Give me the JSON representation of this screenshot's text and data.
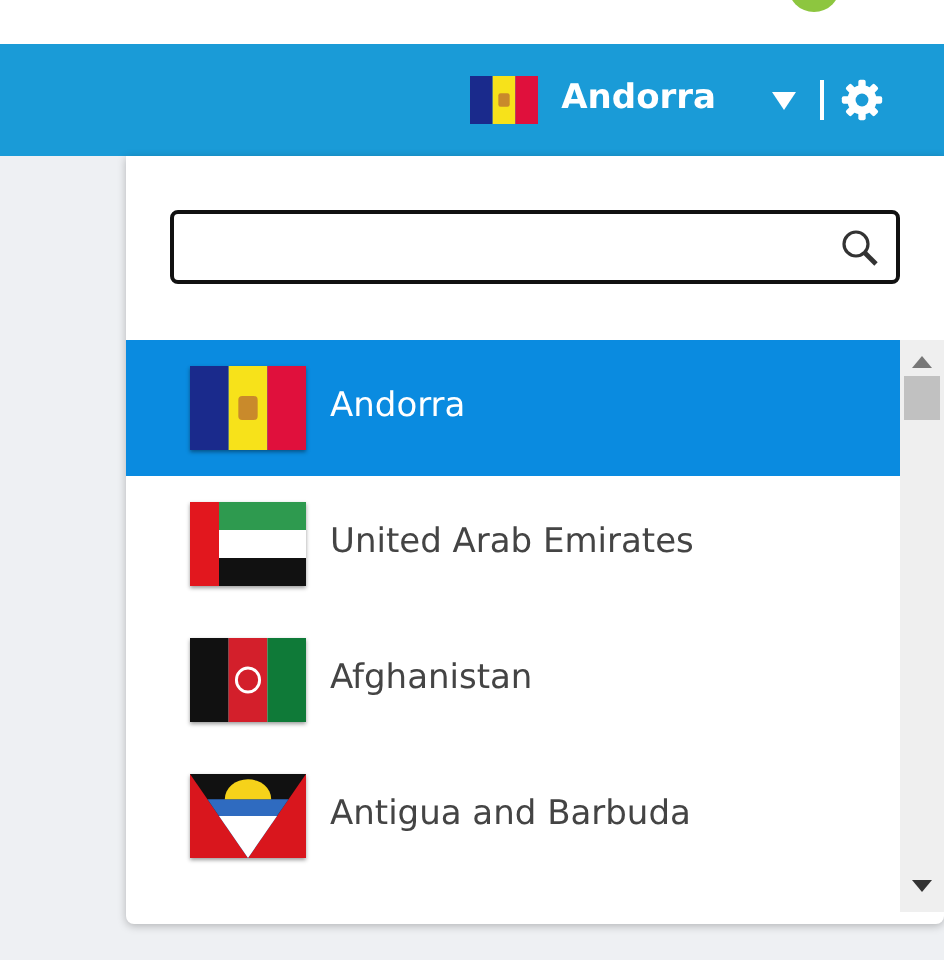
{
  "header": {
    "country": {
      "name": "Andorra",
      "kind": "ad"
    }
  },
  "countries": [
    {
      "name": "Andorra",
      "kind": "ad",
      "selected": true
    },
    {
      "name": "United Arab Emirates",
      "kind": "ae",
      "selected": false
    },
    {
      "name": "Afghanistan",
      "kind": "af",
      "selected": false
    },
    {
      "name": "Antigua and Barbuda",
      "kind": "ag",
      "selected": false
    }
  ]
}
